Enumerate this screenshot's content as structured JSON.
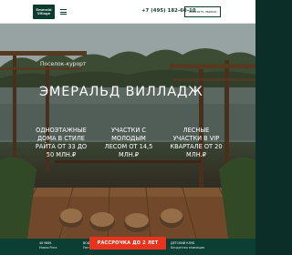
{
  "header": {
    "logo_line1": "Emerald",
    "logo_line2": "Village",
    "phone": "+7 (495) 182-60-10",
    "callback_label": "Заказать звонок"
  },
  "hero": {
    "subtitle": "Поселок-курорт",
    "title": "ЭМЕРАЛЬД ВИЛЛАДЖ",
    "features": [
      {
        "text": "ОДНОЭТАЖНЫЕ ДОМА В СТИЛЕ РАЙТА ОТ 33 ДО 50 МЛН.₽"
      },
      {
        "text": "УЧАСТКИ С МОЛОДЫМ ЛЕСОМ ОТ 14,5 МЛН.₽"
      },
      {
        "text": "ЛЕСНЫЕ УЧАСТКИ В VIP КВАРТАЛЕ ОТ 20 МЛН.₽"
      }
    ]
  },
  "bottom": {
    "items": [
      {
        "title": "40 МИН.",
        "desc": "Новая Рига"
      },
      {
        "title": "ВОДОЕМ",
        "desc": "Песчаный пляж"
      },
      {
        "title": "БАССЕЙН",
        "desc": "СПА, баня"
      },
      {
        "title": "ДЕТСКИЙ КЛУБ",
        "desc": "Бесдонная анимация"
      }
    ],
    "promo_label": "РАССРОЧКА ДО 2 ЛЕТ"
  },
  "colors": {
    "brand_green": "#0f3b2e",
    "promo_red": "#e8331f"
  }
}
